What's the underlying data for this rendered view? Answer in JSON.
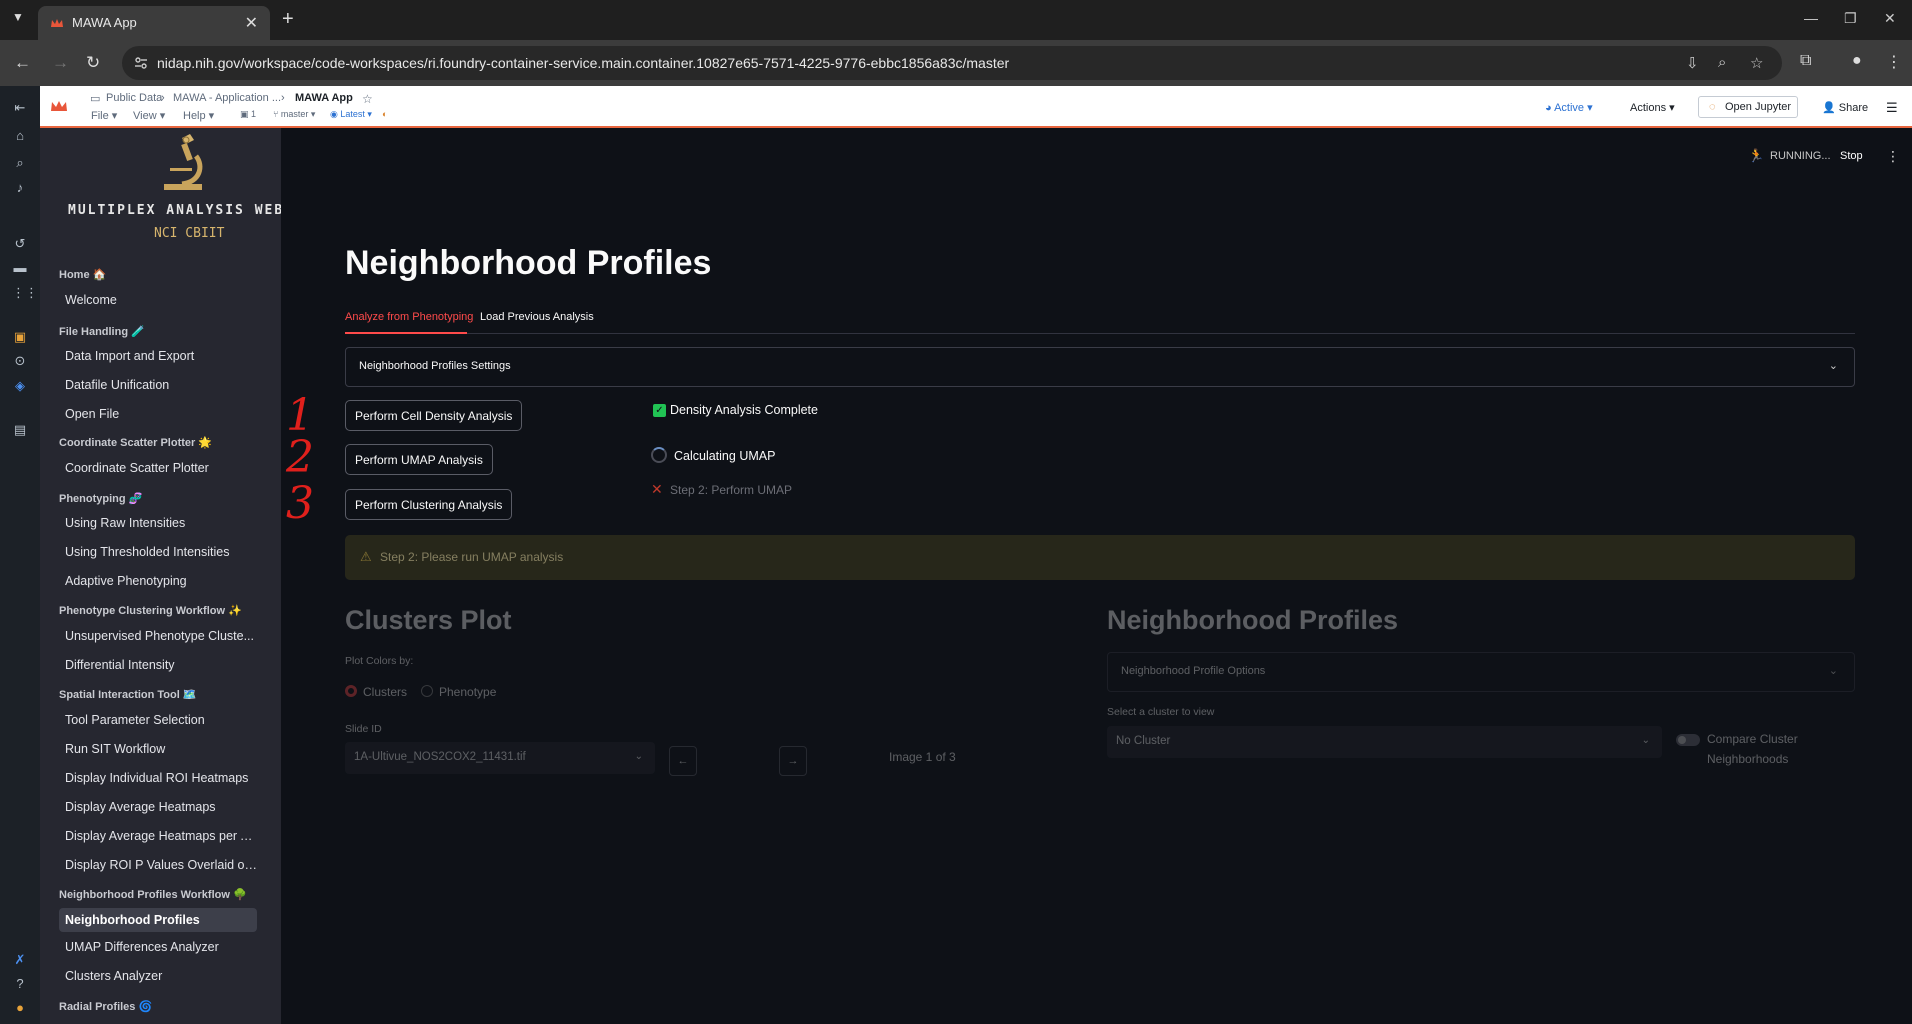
{
  "browser": {
    "tab_title": "MAWA App",
    "url": "nidap.nih.gov/workspace/code-workspaces/ri.foundry-container-service.main.container.10827e65-7571-4225-9776-ebbc1856a83c/master"
  },
  "app_header": {
    "breadcrumb_1": "Public Data",
    "breadcrumb_2": "MAWA - Application ...",
    "breadcrumb_3": "MAWA App",
    "menu_file": "File",
    "menu_view": "View",
    "menu_help": "Help",
    "count": "1",
    "branch": "master",
    "version": "Latest",
    "status": "Active",
    "actions": "Actions",
    "open_jupyter": "Open Jupyter",
    "share": "Share"
  },
  "sidebar": {
    "logo_title": "MULTIPLEX ANALYSIS WEB AP",
    "logo_subtitle": "NCI CBIIT",
    "sections": [
      {
        "head": "Home 🏠",
        "items": [
          "Welcome"
        ]
      },
      {
        "head": "File Handling 🧪",
        "items": [
          "Data Import and Export",
          "Datafile Unification",
          "Open File"
        ]
      },
      {
        "head": "Coordinate Scatter Plotter 🌟",
        "items": [
          "Coordinate Scatter Plotter"
        ]
      },
      {
        "head": "Phenotyping 🧬",
        "items": [
          "Using Raw Intensities",
          "Using Thresholded Intensities",
          "Adaptive Phenotyping"
        ]
      },
      {
        "head": "Phenotype Clustering Workflow ✨",
        "items": [
          "Unsupervised Phenotype Cluste...",
          "Differential Intensity"
        ]
      },
      {
        "head": "Spatial Interaction Tool 🗺️",
        "items": [
          "Tool Parameter Selection",
          "Run SIT Workflow",
          "Display Individual ROI Heatmaps",
          "Display Average Heatmaps",
          "Display Average Heatmaps per A...",
          "Display ROI P Values Overlaid on..."
        ]
      },
      {
        "head": "Neighborhood Profiles Workflow 🌳",
        "items": [
          "Neighborhood Profiles",
          "UMAP Differences Analyzer",
          "Clusters Analyzer"
        ]
      },
      {
        "head": "Radial Profiles 🌀",
        "items": []
      }
    ],
    "active_item": "Neighborhood Profiles"
  },
  "toolbar": {
    "running": "RUNNING...",
    "stop": "Stop"
  },
  "main": {
    "title": "Neighborhood Profiles",
    "tab_1": "Analyze from Phenotyping",
    "tab_2": "Load Previous Analysis",
    "settings_expander": "Neighborhood Profiles Settings",
    "btn_density": "Perform Cell Density Analysis",
    "btn_umap": "Perform UMAP Analysis",
    "btn_cluster": "Perform Clustering Analysis",
    "annot_1": "1",
    "annot_2": "2",
    "annot_3": "3",
    "density_complete": "Density Analysis Complete",
    "calculating": "Calculating UMAP",
    "step2_status": "Step 2: Perform UMAP",
    "warning": "Step 2: Please run UMAP analysis",
    "clusters_title": "Clusters Plot",
    "plot_colors_label": "Plot Colors by:",
    "radio_clusters": "Clusters",
    "radio_phenotype": "Phenotype",
    "slide_id_label": "Slide ID",
    "slide_id_value": "1A-Ultivue_NOS2COX2_11431.tif",
    "image_count": "Image 1 of 3",
    "np_title": "Neighborhood Profiles",
    "np_options": "Neighborhood Profile Options",
    "select_cluster_label": "Select a cluster to view",
    "select_cluster_value": "No Cluster",
    "compare_label_1": "Compare Cluster",
    "compare_label_2": "Neighborhoods"
  },
  "colors": {
    "accent": "#ff4b4b",
    "background": "#0e1117",
    "sidebar": "#262730",
    "success": "#21c354"
  }
}
